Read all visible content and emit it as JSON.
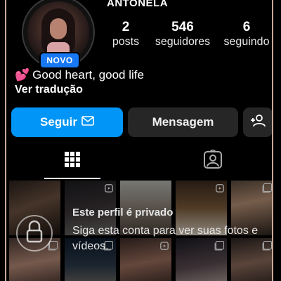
{
  "profile": {
    "username": "ANTONELA",
    "new_badge": "NOVO",
    "avatar_alt": "avatar",
    "stats": [
      {
        "value": "2",
        "label": "posts"
      },
      {
        "value": "546",
        "label": "seguidores"
      },
      {
        "value": "6",
        "label": "seguindo"
      }
    ],
    "bio_emoji": "💕",
    "bio": "Good heart, good life",
    "translate": "Ver tradução"
  },
  "actions": {
    "follow": "Seguir",
    "message": "Mensagem"
  },
  "tabs": [
    "grid-icon",
    "tagged-icon"
  ],
  "private": {
    "title": "Este perfil é privado",
    "text": "Siga esta conta para ver suas fotos e vídeos."
  },
  "colors": {
    "accent": "#0095f6",
    "badge": "#1877f2",
    "button_dark": "#262626",
    "frame": "#c9a898"
  }
}
